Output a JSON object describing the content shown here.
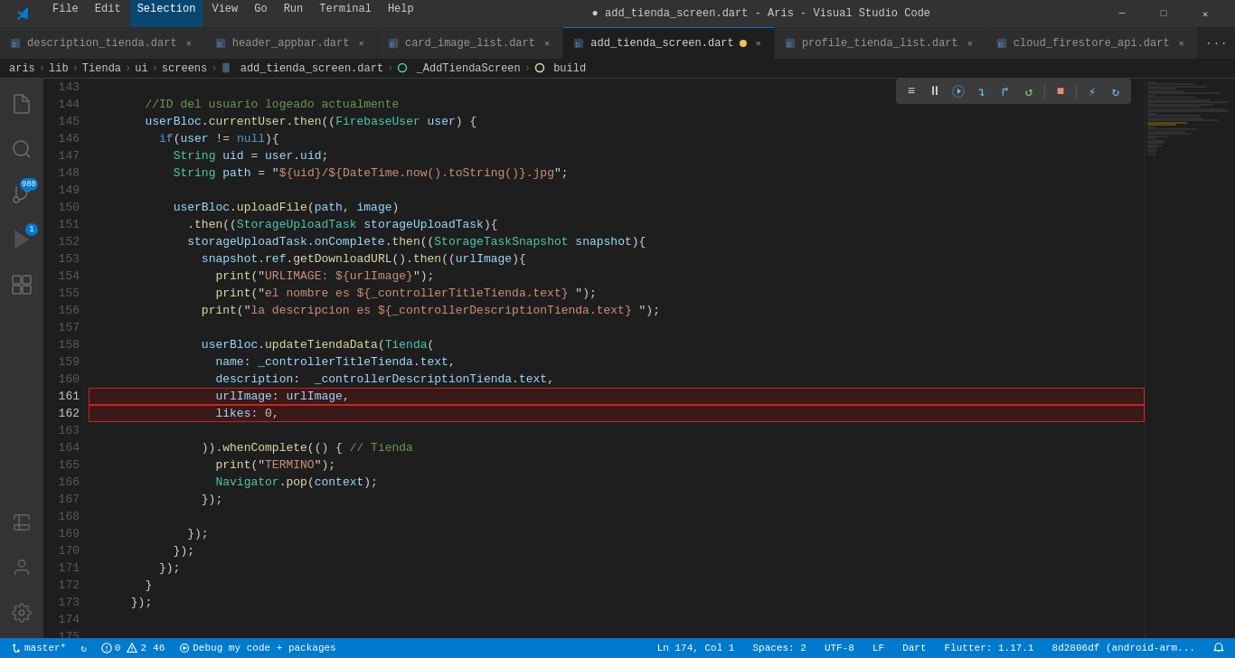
{
  "titlebar": {
    "menu": [
      "File",
      "Edit",
      "Selection",
      "View",
      "Go",
      "Run",
      "Terminal",
      "Help"
    ],
    "active_menu": "Selection",
    "title": "● add_tienda_screen.dart - Aris - Visual Studio Code",
    "controls": [
      "─",
      "□",
      "✕"
    ]
  },
  "tabs": [
    {
      "id": "tab1",
      "label": "description_tienda.dart",
      "icon": "dart",
      "active": false,
      "dirty": false
    },
    {
      "id": "tab2",
      "label": "header_appbar.dart",
      "icon": "dart",
      "active": false,
      "dirty": false
    },
    {
      "id": "tab3",
      "label": "card_image_list.dart",
      "icon": "dart",
      "active": false,
      "dirty": false
    },
    {
      "id": "tab4",
      "label": "add_tienda_screen.dart",
      "icon": "dart",
      "active": true,
      "dirty": true
    },
    {
      "id": "tab5",
      "label": "profile_tienda_list.dart",
      "icon": "dart",
      "active": false,
      "dirty": false
    },
    {
      "id": "tab6",
      "label": "cloud_firestore_api.dart",
      "icon": "dart",
      "active": false,
      "dirty": false
    }
  ],
  "breadcrumb": {
    "parts": [
      "aris",
      "lib",
      "Tienda",
      "ui",
      "screens",
      "add_tienda_screen.dart",
      "_AddTiendaScreen",
      "build"
    ]
  },
  "activity_bar": {
    "items": [
      {
        "icon": "⎘",
        "label": "explorer",
        "active": false
      },
      {
        "icon": "⌕",
        "label": "search",
        "active": false
      },
      {
        "icon": "⑂",
        "label": "source-control",
        "active": false,
        "badge": "988"
      },
      {
        "icon": "▶",
        "label": "run",
        "active": false,
        "badge": "1"
      },
      {
        "icon": "⊞",
        "label": "extensions",
        "active": false
      }
    ],
    "bottom": [
      {
        "icon": "⚗",
        "label": "test"
      },
      {
        "icon": "◈",
        "label": "remote"
      },
      {
        "icon": "👤",
        "label": "account"
      },
      {
        "icon": "⚙",
        "label": "settings"
      }
    ]
  },
  "code": {
    "lines": [
      {
        "num": 143,
        "content": ""
      },
      {
        "num": 144,
        "tokens": [
          {
            "t": "cm",
            "v": "        //ID del usuario logeado actualmente"
          }
        ]
      },
      {
        "num": 145,
        "tokens": [
          {
            "t": "plain",
            "v": "        "
          },
          {
            "t": "var",
            "v": "userBloc"
          },
          {
            "t": "plain",
            "v": "."
          },
          {
            "t": "fn",
            "v": "currentUser"
          },
          {
            "t": "plain",
            "v": "."
          },
          {
            "t": "fn",
            "v": "then"
          },
          {
            "t": "plain",
            "v": "(("
          },
          {
            "t": "cls",
            "v": "FirebaseUser"
          },
          {
            "t": "plain",
            "v": " "
          },
          {
            "t": "var",
            "v": "user"
          },
          {
            "t": "plain",
            "v": ") {"
          }
        ]
      },
      {
        "num": 146,
        "tokens": [
          {
            "t": "plain",
            "v": "          "
          },
          {
            "t": "kw",
            "v": "if"
          },
          {
            "t": "plain",
            "v": "("
          },
          {
            "t": "var",
            "v": "user"
          },
          {
            "t": "plain",
            "v": " != "
          },
          {
            "t": "kw",
            "v": "null"
          },
          {
            "t": "plain",
            "v": "){"
          }
        ]
      },
      {
        "num": 147,
        "tokens": [
          {
            "t": "plain",
            "v": "            "
          },
          {
            "t": "cls",
            "v": "String"
          },
          {
            "t": "plain",
            "v": " "
          },
          {
            "t": "var",
            "v": "uid"
          },
          {
            "t": "plain",
            "v": " = "
          },
          {
            "t": "var",
            "v": "user"
          },
          {
            "t": "plain",
            "v": "."
          },
          {
            "t": "prop",
            "v": "uid"
          },
          {
            "t": "plain",
            "v": ";"
          }
        ]
      },
      {
        "num": 148,
        "tokens": [
          {
            "t": "plain",
            "v": "            "
          },
          {
            "t": "cls",
            "v": "String"
          },
          {
            "t": "plain",
            "v": " "
          },
          {
            "t": "var",
            "v": "path"
          },
          {
            "t": "plain",
            "v": " = \""
          },
          {
            "t": "str",
            "v": "${uid}/${DateTime.now().toString()}.jpg"
          },
          {
            "t": "plain",
            "v": "\";"
          }
        ]
      },
      {
        "num": 149,
        "content": ""
      },
      {
        "num": 150,
        "tokens": [
          {
            "t": "plain",
            "v": "            "
          },
          {
            "t": "var",
            "v": "userBloc"
          },
          {
            "t": "plain",
            "v": "."
          },
          {
            "t": "fn",
            "v": "uploadFile"
          },
          {
            "t": "plain",
            "v": "("
          },
          {
            "t": "var",
            "v": "path"
          },
          {
            "t": "plain",
            "v": ", "
          },
          {
            "t": "var",
            "v": "image"
          },
          {
            "t": "plain",
            "v": ")"
          }
        ]
      },
      {
        "num": 151,
        "tokens": [
          {
            "t": "plain",
            "v": "              ."
          },
          {
            "t": "fn",
            "v": "then"
          },
          {
            "t": "plain",
            "v": "(("
          },
          {
            "t": "cls",
            "v": "StorageUploadTask"
          },
          {
            "t": "plain",
            "v": " "
          },
          {
            "t": "var",
            "v": "storageUploadTask"
          },
          {
            "t": "plain",
            "v": "){"
          }
        ]
      },
      {
        "num": 152,
        "tokens": [
          {
            "t": "plain",
            "v": "              "
          },
          {
            "t": "var",
            "v": "storageUploadTask"
          },
          {
            "t": "plain",
            "v": "."
          },
          {
            "t": "prop",
            "v": "onComplete"
          },
          {
            "t": "plain",
            "v": "."
          },
          {
            "t": "fn",
            "v": "then"
          },
          {
            "t": "plain",
            "v": "(("
          },
          {
            "t": "cls",
            "v": "StorageTaskSnapshot"
          },
          {
            "t": "plain",
            "v": " "
          },
          {
            "t": "var",
            "v": "snapshot"
          },
          {
            "t": "plain",
            "v": "){"
          }
        ]
      },
      {
        "num": 153,
        "tokens": [
          {
            "t": "plain",
            "v": "                "
          },
          {
            "t": "var",
            "v": "snapshot"
          },
          {
            "t": "plain",
            "v": "."
          },
          {
            "t": "prop",
            "v": "ref"
          },
          {
            "t": "plain",
            "v": "."
          },
          {
            "t": "fn",
            "v": "getDownloadURL"
          },
          {
            "t": "plain",
            "v": "()."
          },
          {
            "t": "fn",
            "v": "then"
          },
          {
            "t": "plain",
            "v": "(("
          },
          {
            "t": "var",
            "v": "urlImage"
          },
          {
            "t": "plain",
            "v": "){"
          }
        ]
      },
      {
        "num": 154,
        "tokens": [
          {
            "t": "plain",
            "v": "                  "
          },
          {
            "t": "fn",
            "v": "print"
          },
          {
            "t": "plain",
            "v": "(\""
          },
          {
            "t": "str",
            "v": "URLIMAGE: ${urlImage}"
          },
          {
            "t": "plain",
            "v": "\");"
          }
        ]
      },
      {
        "num": 155,
        "tokens": [
          {
            "t": "plain",
            "v": "                  "
          },
          {
            "t": "fn",
            "v": "print"
          },
          {
            "t": "plain",
            "v": "(\""
          },
          {
            "t": "str",
            "v": "el nombre es ${_controllerTitleTienda.text}"
          },
          {
            "t": "plain",
            "v": " \");"
          }
        ]
      },
      {
        "num": 156,
        "tokens": [
          {
            "t": "plain",
            "v": "                "
          },
          {
            "t": "fn",
            "v": "print"
          },
          {
            "t": "plain",
            "v": "(\""
          },
          {
            "t": "str",
            "v": "la descripcion es ${_controllerDescriptionTienda.text}"
          },
          {
            "t": "plain",
            "v": " \");"
          }
        ]
      },
      {
        "num": 157,
        "content": ""
      },
      {
        "num": 158,
        "tokens": [
          {
            "t": "plain",
            "v": "                "
          },
          {
            "t": "var",
            "v": "userBloc"
          },
          {
            "t": "plain",
            "v": "."
          },
          {
            "t": "fn",
            "v": "updateTiendaData"
          },
          {
            "t": "plain",
            "v": "("
          },
          {
            "t": "cls",
            "v": "Tienda"
          },
          {
            "t": "plain",
            "v": "("
          }
        ]
      },
      {
        "num": 159,
        "tokens": [
          {
            "t": "plain",
            "v": "                  "
          },
          {
            "t": "prop",
            "v": "name"
          },
          {
            "t": "plain",
            "v": ": "
          },
          {
            "t": "var",
            "v": "_controllerTitleTienda"
          },
          {
            "t": "plain",
            "v": "."
          },
          {
            "t": "prop",
            "v": "text"
          },
          {
            "t": "plain",
            "v": ","
          }
        ]
      },
      {
        "num": 160,
        "tokens": [
          {
            "t": "plain",
            "v": "                  "
          },
          {
            "t": "prop",
            "v": "description"
          },
          {
            "t": "plain",
            "v": ":  "
          },
          {
            "t": "var",
            "v": "_controllerDescriptionTienda"
          },
          {
            "t": "plain",
            "v": "."
          },
          {
            "t": "prop",
            "v": "text"
          },
          {
            "t": "plain",
            "v": ","
          }
        ]
      },
      {
        "num": 161,
        "tokens": [
          {
            "t": "plain",
            "v": "                  "
          },
          {
            "t": "prop",
            "v": "urlImage"
          },
          {
            "t": "plain",
            "v": ": "
          },
          {
            "t": "var",
            "v": "urlImage"
          },
          {
            "t": "plain",
            "v": ","
          }
        ],
        "selected": true
      },
      {
        "num": 162,
        "tokens": [
          {
            "t": "plain",
            "v": "                  "
          },
          {
            "t": "prop",
            "v": "likes"
          },
          {
            "t": "plain",
            "v": ": "
          },
          {
            "t": "num",
            "v": "0"
          },
          {
            "t": "plain",
            "v": ","
          }
        ],
        "selected": true
      },
      {
        "num": 163,
        "content": ""
      },
      {
        "num": 164,
        "tokens": [
          {
            "t": "plain",
            "v": "                ))."
          },
          {
            "t": "fn",
            "v": "whenComplete"
          },
          {
            "t": "plain",
            "v": "(() { "
          },
          {
            "t": "cm",
            "v": "// Tienda"
          }
        ]
      },
      {
        "num": 165,
        "tokens": [
          {
            "t": "plain",
            "v": "                  "
          },
          {
            "t": "fn",
            "v": "print"
          },
          {
            "t": "plain",
            "v": "(\""
          },
          {
            "t": "str",
            "v": "TERMINO"
          },
          {
            "t": "plain",
            "v": "\");"
          }
        ]
      },
      {
        "num": 166,
        "tokens": [
          {
            "t": "plain",
            "v": "                  "
          },
          {
            "t": "cls",
            "v": "Navigator"
          },
          {
            "t": "plain",
            "v": "."
          },
          {
            "t": "fn",
            "v": "pop"
          },
          {
            "t": "plain",
            "v": "("
          },
          {
            "t": "var",
            "v": "context"
          },
          {
            "t": "plain",
            "v": ");"
          }
        ]
      },
      {
        "num": 167,
        "tokens": [
          {
            "t": "plain",
            "v": "                });"
          }
        ]
      },
      {
        "num": 168,
        "content": ""
      },
      {
        "num": 169,
        "tokens": [
          {
            "t": "plain",
            "v": "              });"
          }
        ]
      },
      {
        "num": 170,
        "tokens": [
          {
            "t": "plain",
            "v": "            });"
          }
        ]
      },
      {
        "num": 171,
        "tokens": [
          {
            "t": "plain",
            "v": "          });"
          }
        ]
      },
      {
        "num": 172,
        "tokens": [
          {
            "t": "plain",
            "v": "        }"
          }
        ]
      },
      {
        "num": 173,
        "tokens": [
          {
            "t": "plain",
            "v": "      });"
          }
        ]
      },
      {
        "num": 174,
        "content": ""
      },
      {
        "num": 175,
        "content": ""
      }
    ]
  },
  "status_bar": {
    "branch": "master*",
    "sync_icon": "↻",
    "errors": "0",
    "warnings": "2",
    "info": "46",
    "position": "Ln 174, Col 1",
    "spaces": "Spaces: 2",
    "encoding": "UTF-8",
    "line_ending": "LF",
    "language": "Dart",
    "flutter": "Flutter: 1.17.1",
    "device": "8d2806df (android-arm...",
    "debug_label": "Debug my code + packages"
  },
  "debug_toolbar": {
    "buttons": [
      {
        "icon": "≡",
        "label": "menu"
      },
      {
        "icon": "⏸",
        "label": "pause"
      },
      {
        "icon": "↷",
        "label": "step-over"
      },
      {
        "icon": "↴",
        "label": "step-into"
      },
      {
        "icon": "↱",
        "label": "step-out"
      },
      {
        "icon": "↺",
        "label": "restart"
      },
      {
        "icon": "■",
        "label": "stop",
        "color": "red"
      },
      {
        "icon": "↻",
        "label": "hot-reload",
        "color": "blue"
      }
    ]
  }
}
